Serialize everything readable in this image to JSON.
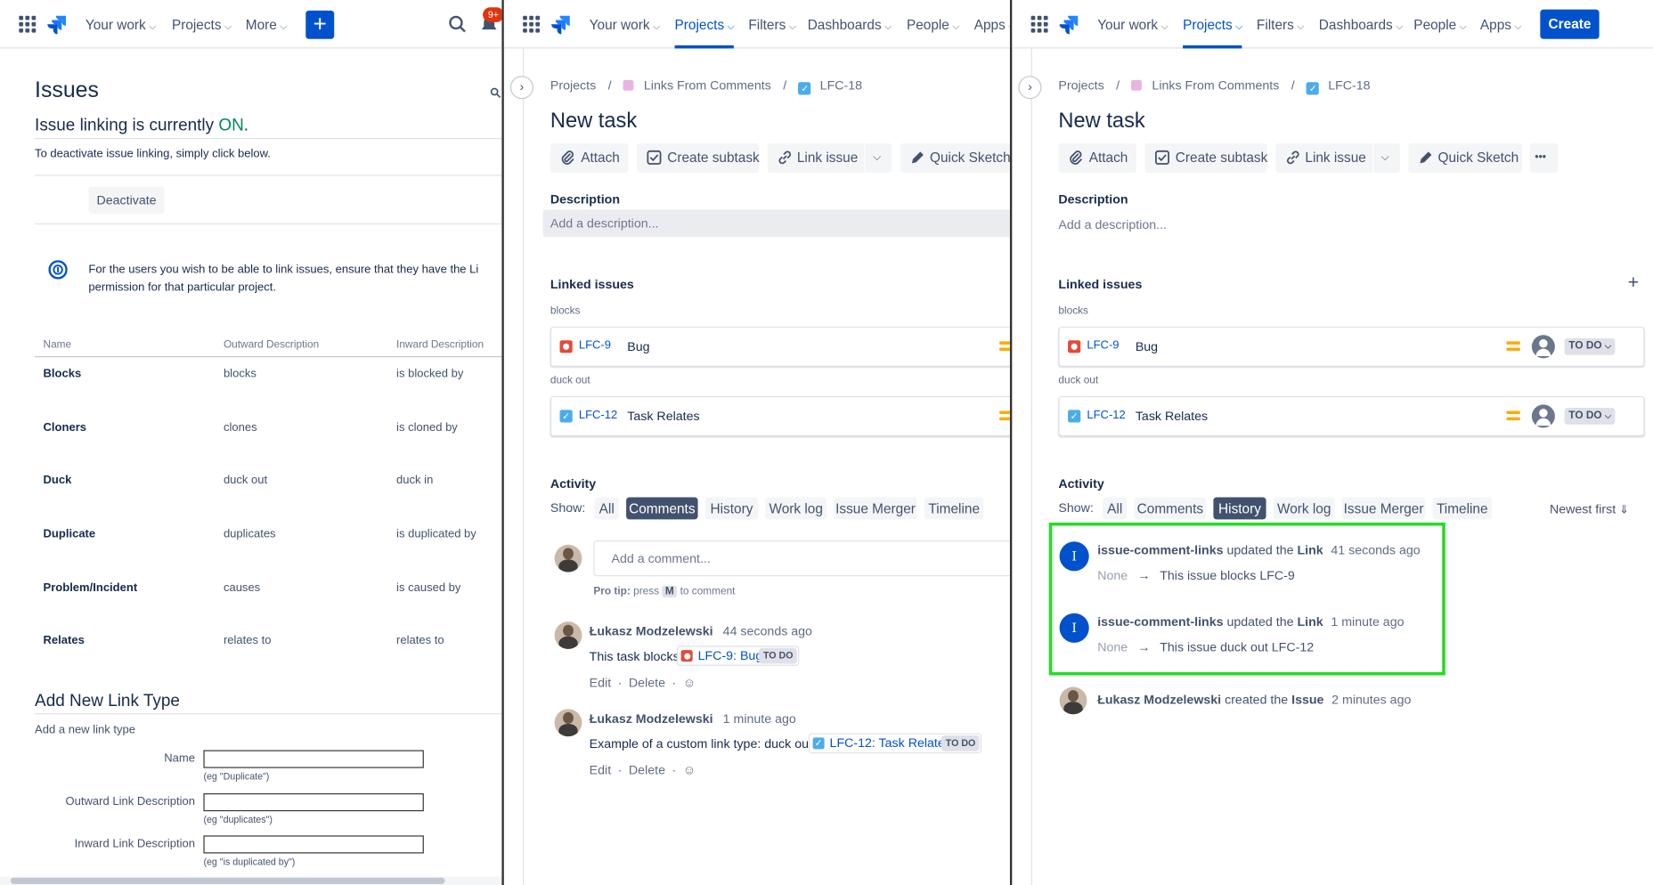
{
  "left": {
    "nav": {
      "your_work": "Your work",
      "projects": "Projects",
      "more": "More",
      "plus": "+",
      "notif_badge": "9+"
    },
    "page_title": "Issues",
    "linking_prefix": "Issue linking is currently ",
    "linking_state": "ON",
    "linking_suffix": ".",
    "deactivate_hint": "To deactivate issue linking, simply click below.",
    "deactivate_button": "Deactivate",
    "info_line1": "For the users you wish to be able to link issues, ensure that they have the Li",
    "info_line2": "permission for that particular project.",
    "table_headers": [
      "Name",
      "Outward Description",
      "Inward Description"
    ],
    "link_types": [
      {
        "name": "Blocks",
        "outward": "blocks",
        "inward": "is blocked by"
      },
      {
        "name": "Cloners",
        "outward": "clones",
        "inward": "is cloned by"
      },
      {
        "name": "Duck",
        "outward": "duck out",
        "inward": "duck in"
      },
      {
        "name": "Duplicate",
        "outward": "duplicates",
        "inward": "is duplicated by"
      },
      {
        "name": "Problem/Incident",
        "outward": "causes",
        "inward": "is caused by"
      },
      {
        "name": "Relates",
        "outward": "relates to",
        "inward": "relates to"
      }
    ],
    "add_title": "Add New Link Type",
    "add_subtitle": "Add a new link type",
    "form": [
      {
        "label": "Name",
        "hint": "(eg \"Duplicate\")"
      },
      {
        "label": "Outward Link Description",
        "hint": "(eg \"duplicates\")"
      },
      {
        "label": "Inward Link Description",
        "hint": "(eg \"is duplicated by\")"
      }
    ]
  },
  "mid": {
    "nav": {
      "your_work": "Your work",
      "projects": "Projects",
      "filters": "Filters",
      "dashboards": "Dashboards",
      "people": "People",
      "apps": "Apps"
    },
    "breadcrumb": {
      "projects": "Projects",
      "sep": "/",
      "project": "Links From Comments",
      "issue": "LFC-18"
    },
    "issue_title": "New task",
    "actions": {
      "attach": "Attach",
      "subtask": "Create subtask",
      "link": "Link issue",
      "sketch": "Quick Sketch"
    },
    "description_label": "Description",
    "description_placeholder": "Add a description...",
    "linked_label": "Linked issues",
    "groups": [
      {
        "type": "blocks",
        "key": "LFC-9",
        "summary": "Bug"
      },
      {
        "type": "duck out",
        "key": "LFC-12",
        "summary": "Task Relates"
      }
    ],
    "activity_label": "Activity",
    "show_label": "Show:",
    "tabs": [
      "All",
      "Comments",
      "History",
      "Work log",
      "Issue Merger",
      "Timeline"
    ],
    "comment_placeholder": "Add a comment...",
    "protip_prefix": "Pro tip:",
    "protip_press": "press",
    "protip_key": "M",
    "protip_suffix": "to comment",
    "comments": [
      {
        "author": "Łukasz Modzelewski",
        "time": "44 seconds ago",
        "text": "This task blocks",
        "chip": "LFC-9: Bug",
        "status": "TO DO"
      },
      {
        "author": "Łukasz Modzelewski",
        "time": "1 minute ago",
        "text": "Example of a custom link type: duck out",
        "chip": "LFC-12: Task Relates",
        "status": "TO DO"
      }
    ],
    "edit": "Edit",
    "delete": "Delete",
    "dot": "·"
  },
  "right": {
    "nav": {
      "your_work": "Your work",
      "projects": "Projects",
      "filters": "Filters",
      "dashboards": "Dashboards",
      "people": "People",
      "apps": "Apps",
      "create": "Create"
    },
    "breadcrumb": {
      "projects": "Projects",
      "sep": "/",
      "project": "Links From Comments",
      "issue": "LFC-18"
    },
    "issue_title": "New task",
    "actions": {
      "attach": "Attach",
      "subtask": "Create subtask",
      "link": "Link issue",
      "sketch": "Quick Sketch",
      "more": "•••"
    },
    "description_label": "Description",
    "description_placeholder": "Add a description...",
    "linked_label": "Linked issues",
    "add_link": "+",
    "groups": [
      {
        "type": "blocks",
        "key": "LFC-9",
        "summary": "Bug",
        "status": "TO DO"
      },
      {
        "type": "duck out",
        "key": "LFC-12",
        "summary": "Task Relates",
        "status": "TO DO"
      }
    ],
    "activity_label": "Activity",
    "show_label": "Show:",
    "tabs": [
      "All",
      "Comments",
      "History",
      "Work log",
      "Issue Merger",
      "Timeline"
    ],
    "sort": "Newest first",
    "history": [
      {
        "avatar": "I",
        "actor": "issue-comment-links",
        "verb": "updated the",
        "field": "Link",
        "time": "41 seconds ago",
        "from": "None",
        "arrow": "→",
        "to": "This issue blocks LFC-9"
      },
      {
        "avatar": "I",
        "actor": "issue-comment-links",
        "verb": "updated the",
        "field": "Link",
        "time": "1 minute ago",
        "from": "None",
        "arrow": "→",
        "to": "This issue duck out LFC-12"
      }
    ],
    "created": {
      "actor": "Łukasz Modzelewski",
      "verb": "created the",
      "field": "Issue",
      "time": "2 minutes ago"
    }
  },
  "colors": {
    "accent": "#0052cc",
    "on_green": "#00875a",
    "highlight_box": "#22dd22",
    "priority": "#ffab00",
    "bug": "#e5493a",
    "task": "#4bade8"
  }
}
